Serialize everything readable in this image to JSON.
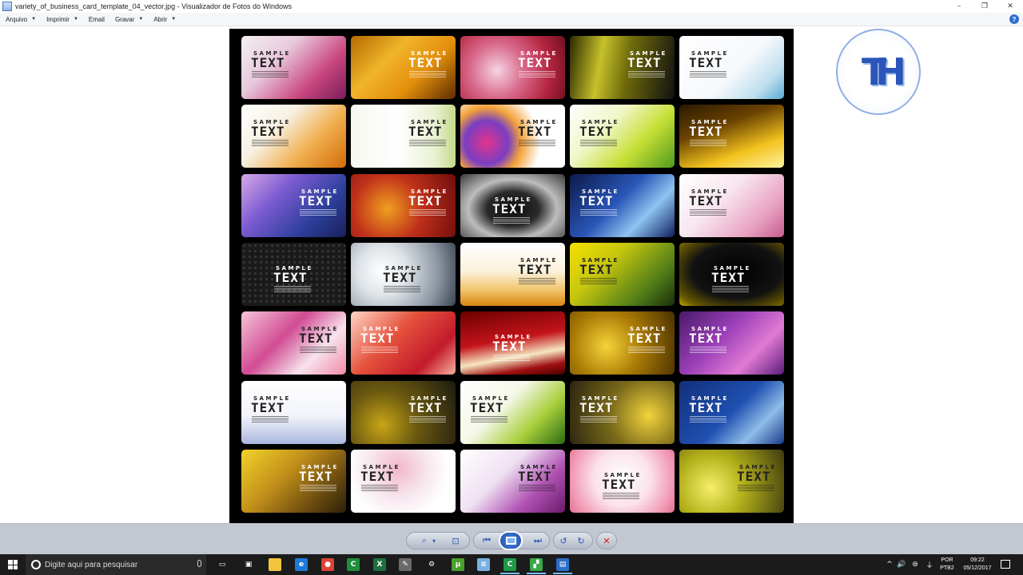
{
  "window": {
    "title": "variety_of_business_card_template_04_vector.jpg - Visualizador de Fotos do Windows",
    "controls": {
      "minimize": "–",
      "restore": "❐",
      "close": "✕"
    }
  },
  "menu": {
    "items": [
      {
        "label": "Arquivo",
        "caret": "▼"
      },
      {
        "label": "Imprimir",
        "caret": "▼"
      },
      {
        "label": "Email",
        "caret": ""
      },
      {
        "label": "Gravar",
        "caret": "▼"
      },
      {
        "label": "Abrir",
        "caret": "▼"
      }
    ],
    "help": "?"
  },
  "cards": [
    {
      "l1": "SAMPLE",
      "l2": "TEXT",
      "bg": "linear-gradient(135deg,#f3f0f2 0%,#e8c9dc 35%,#c9467e 70%,#7a1d5a 100%)",
      "ink": "#222222",
      "align": "left"
    },
    {
      "l1": "SAMPLE",
      "l2": "TEXT",
      "bg": "linear-gradient(135deg,#b36a00 0%,#f0b42a 35%,#e38f0c 65%,#5c2c00 100%)",
      "ink": "#ffffff",
      "align": "right"
    },
    {
      "l1": "SAMPLE",
      "l2": "TEXT",
      "bg": "radial-gradient(circle at 35% 55%,#f6d3e3 0%,#d96a8c 35%,#b3243e 70%,#6d1020 100%)",
      "ink": "#ffffff",
      "align": "right"
    },
    {
      "l1": "SAMPLE",
      "l2": "TEXT",
      "bg": "linear-gradient(100deg,#2b2b00 0%,#c7c12a 30%,#6e6a0a 55%,#111111 100%)",
      "ink": "#ffffff",
      "align": "right"
    },
    {
      "l1": "SAMPLE",
      "l2": "TEXT",
      "bg": "linear-gradient(135deg,#ffffff 0%,#f5f8fb 55%,#bfe0ee 80%,#5aa9d1 100%)",
      "ink": "#222222",
      "align": "left"
    },
    {
      "l1": "SAMPLE",
      "l2": "TEXT",
      "bg": "linear-gradient(135deg,#ffffff 0%,#f7f0e2 35%,#f0b050 65%,#d36a06 100%)",
      "ink": "#222222",
      "align": "left"
    },
    {
      "l1": "SAMPLE",
      "l2": "TEXT",
      "bg": "linear-gradient(90deg,#f5f7ef 0%,#ffffff 45%,#e9f1d2 80%,#c3da8a 100%)",
      "ink": "#222222",
      "align": "right"
    },
    {
      "l1": "SAMPLE",
      "l2": "TEXT",
      "bg": "radial-gradient(circle at 25% 60%,#e2338c 0%,#7a3ec2 25%,#f3a33a 40%,#ffffff 62%)",
      "ink": "#222222",
      "align": "right"
    },
    {
      "l1": "SAMPLE",
      "l2": "TEXT",
      "bg": "linear-gradient(135deg,#ffffff 0%,#f0f6c8 35%,#c6df35 65%,#4f9a1c 100%)",
      "ink": "#222222",
      "align": "left"
    },
    {
      "l1": "SAMPLE",
      "l2": "TEXT",
      "bg": "linear-gradient(160deg,#2a1a00 0%,#6a4200 35%,#f2c21e 70%,#fff4a0 100%)",
      "ink": "#ffffff",
      "align": "left"
    },
    {
      "l1": "SAMPLE",
      "l2": "TEXT",
      "bg": "linear-gradient(135deg,#d7a8e8 0%,#7a5ad0 35%,#2b3f9a 70%,#1b1f5a 100%)",
      "ink": "#ffffff",
      "align": "right"
    },
    {
      "l1": "SAMPLE",
      "l2": "TEXT",
      "bg": "radial-gradient(circle at 35% 55%,#f0a020 0%,#c0301a 45%,#6d0d0d 100%)",
      "ink": "#ffffff",
      "align": "right"
    },
    {
      "l1": "SAMPLE",
      "l2": "TEXT",
      "bg": "radial-gradient(ellipse at 50% 55%,#0b0b0b 0%,#2a2a2a 35%,#bdbdbd 60%,#3a3a3a 100%)",
      "ink": "#ffffff",
      "align": "center"
    },
    {
      "l1": "SAMPLE",
      "l2": "TEXT",
      "bg": "linear-gradient(135deg,#0c1a4a 0%,#2a56b8 45%,#8ec3f0 70%,#0d1f60 100%)",
      "ink": "#ffffff",
      "align": "left"
    },
    {
      "l1": "SAMPLE",
      "l2": "TEXT",
      "bg": "linear-gradient(135deg,#ffffff 0%,#f8e6ef 40%,#e8a2c1 75%,#c65c8f 100%)",
      "ink": "#222222",
      "align": "left"
    },
    {
      "l1": "SAMPLE",
      "l2": "TEXT",
      "bg": "radial-gradient(circle,#3a3a3a 1px,#1a1a1a 2px) 0 0/7px 7px",
      "ink": "#ffffff",
      "align": "center"
    },
    {
      "l1": "SAMPLE",
      "l2": "TEXT",
      "bg": "radial-gradient(circle at 30% 45%,#ffffff 0%,#dfe4e8 30%,#8a95a0 70%,#3a4450 100%)",
      "ink": "#222222",
      "align": "center"
    },
    {
      "l1": "SAMPLE",
      "l2": "TEXT",
      "bg": "linear-gradient(180deg,#ffffff 0%,#fbf2dc 45%,#f1c46b 75%,#d9860f 100%)",
      "ink": "#222222",
      "align": "right"
    },
    {
      "l1": "SAMPLE",
      "l2": "TEXT",
      "bg": "linear-gradient(135deg,#f4e000 0%,#c6c60f 35%,#4c7a18 75%,#1a2e0a 100%)",
      "ink": "#222222",
      "align": "left"
    },
    {
      "l1": "SAMPLE",
      "l2": "TEXT",
      "bg": "radial-gradient(ellipse at 55% 45%,#000000 0%,#121212 55%,#6a5a00 85%,#c2a800 100%)",
      "ink": "#ffffff",
      "align": "center"
    },
    {
      "l1": "SAMPLE",
      "l2": "TEXT",
      "bg": "linear-gradient(135deg,#f6c5d8 0%,#d14b93 40%,#f7e2ec 70%,#f08aa8 100%)",
      "ink": "#222222",
      "align": "right"
    },
    {
      "l1": "SAMPLE",
      "l2": "TEXT",
      "bg": "linear-gradient(135deg,#ffd6c8 0%,#e5533d 40%,#c21a2a 75%,#f7b0a0 100%)",
      "ink": "#ffffff",
      "align": "left"
    },
    {
      "l1": "SAMPLE",
      "l2": "TEXT",
      "bg": "linear-gradient(170deg,#6d0000 0%,#c4141a 45%,#f5e6c0 68%,#a10f12 85%,#4a0000 100%)",
      "ink": "#ffffff",
      "align": "center"
    },
    {
      "l1": "SAMPLE",
      "l2": "TEXT",
      "bg": "radial-gradient(circle at 35% 55%,#f6d43a 0%,#a97a05 45%,#4a3000 100%)",
      "ink": "#ffffff",
      "align": "right"
    },
    {
      "l1": "SAMPLE",
      "l2": "TEXT",
      "bg": "linear-gradient(135deg,#4a1a6a 0%,#9a3fb8 40%,#e27ad4 70%,#5a1d7a 100%)",
      "ink": "#ffffff",
      "align": "left"
    },
    {
      "l1": "SAMPLE",
      "l2": "TEXT",
      "bg": "linear-gradient(180deg,#ffffff 0%,#f2f4fa 55%,#cdd5ec 80%,#a8b6de 100%)",
      "ink": "#222222",
      "align": "left"
    },
    {
      "l1": "SAMPLE",
      "l2": "TEXT",
      "bg": "radial-gradient(circle at 30% 70%,#c8a516 0%,#6c5a10 40%,#1c1a10 100%)",
      "ink": "#ffffff",
      "align": "right"
    },
    {
      "l1": "SAMPLE",
      "l2": "TEXT",
      "bg": "linear-gradient(135deg,#ffffff 0%,#f4f8e8 40%,#a9cf3c 70%,#2b6b12 100%)",
      "ink": "#222222",
      "align": "left"
    },
    {
      "l1": "SAMPLE",
      "l2": "TEXT",
      "bg": "radial-gradient(circle at 75% 55%,#f2d43c 0%,#7a6a1a 45%,#2a2410 100%)",
      "ink": "#ffffff",
      "align": "left"
    },
    {
      "l1": "SAMPLE",
      "l2": "TEXT",
      "bg": "linear-gradient(135deg,#12307a 0%,#1f4fb0 50%,#8ebce8 75%,#1a3b8a 100%)",
      "ink": "#ffffff",
      "align": "left"
    },
    {
      "l1": "SAMPLE",
      "l2": "TEXT",
      "bg": "linear-gradient(135deg,#f2d22a 0%,#c2901a 40%,#6a4a10 75%,#2a2008 100%)",
      "ink": "#ffffff",
      "align": "right"
    },
    {
      "l1": "SAMPLE",
      "l2": "TEXT",
      "bg": "radial-gradient(circle at 45% 30%,#f2b7c8 0%,#f7e6ee 40%,#ffffff 70%)",
      "ink": "#222222",
      "align": "left"
    },
    {
      "l1": "SAMPLE",
      "l2": "TEXT",
      "bg": "linear-gradient(135deg,#ffffff 0%,#efe0f2 40%,#b053b4 70%,#6a1a6a 100%)",
      "ink": "#222222",
      "align": "right"
    },
    {
      "l1": "SAMPLE",
      "l2": "TEXT",
      "bg": "radial-gradient(circle at 50% 45%,#ffffff 0%,#fbe2ea 45%,#f19ab6 80%,#e2718f 100%)",
      "ink": "#222222",
      "align": "center"
    },
    {
      "l1": "SAMPLE",
      "l2": "TEXT",
      "bg": "radial-gradient(circle at 30% 60%,#f6ef6a 0%,#b3b01a 40%,#3d3a10 100%)",
      "ink": "#222222",
      "align": "right"
    }
  ],
  "logo": {
    "mark": "TH"
  },
  "toolbar": {
    "zoom": "⌕",
    "zoom_caret": "▾",
    "actual_size": "⊡",
    "prev": "⏮",
    "slideshow": "▭",
    "next": "⏭",
    "rotate_ccw": "↺",
    "rotate_cw": "↻",
    "delete": "✕"
  },
  "taskbar": {
    "search_placeholder": "Digite aqui para pesquisar",
    "language": "POR",
    "language_variant": "PTB2",
    "time": "09:22",
    "date": "05/12/2017",
    "tray": {
      "chevron": "^",
      "volume": "🔊",
      "network": "⊜",
      "usb": "⏚"
    },
    "apps": [
      {
        "name": "task-view-icon",
        "glyph": "▭",
        "color": "#1b1b1c"
      },
      {
        "name": "store-icon",
        "glyph": "▣",
        "color": "#1b1b1c"
      },
      {
        "name": "file-explorer-icon",
        "glyph": "",
        "color": "#f3c53c"
      },
      {
        "name": "edge-icon",
        "glyph": "e",
        "color": "#1e7ad8"
      },
      {
        "name": "chrome-icon",
        "glyph": "●",
        "color": "#db4437"
      },
      {
        "name": "camtasia-icon",
        "glyph": "C",
        "color": "#1f8f3a"
      },
      {
        "name": "excel-icon",
        "glyph": "X",
        "color": "#1d6f3f"
      },
      {
        "name": "paint-icon",
        "glyph": "✎",
        "color": "#6a6a6a"
      },
      {
        "name": "settings-icon",
        "glyph": "⚙",
        "color": "#1b1b1c"
      },
      {
        "name": "utorrent-icon",
        "glyph": "µ",
        "color": "#4aa02c"
      },
      {
        "name": "notes-icon",
        "glyph": "≡",
        "color": "#7ab0e0"
      },
      {
        "name": "camtasia-recorder-icon",
        "glyph": "C",
        "color": "#1e9a48"
      },
      {
        "name": "image-icon",
        "glyph": "▞",
        "color": "#3aa84a"
      },
      {
        "name": "photo-viewer-icon",
        "glyph": "▤",
        "color": "#2a6fc8"
      }
    ]
  }
}
